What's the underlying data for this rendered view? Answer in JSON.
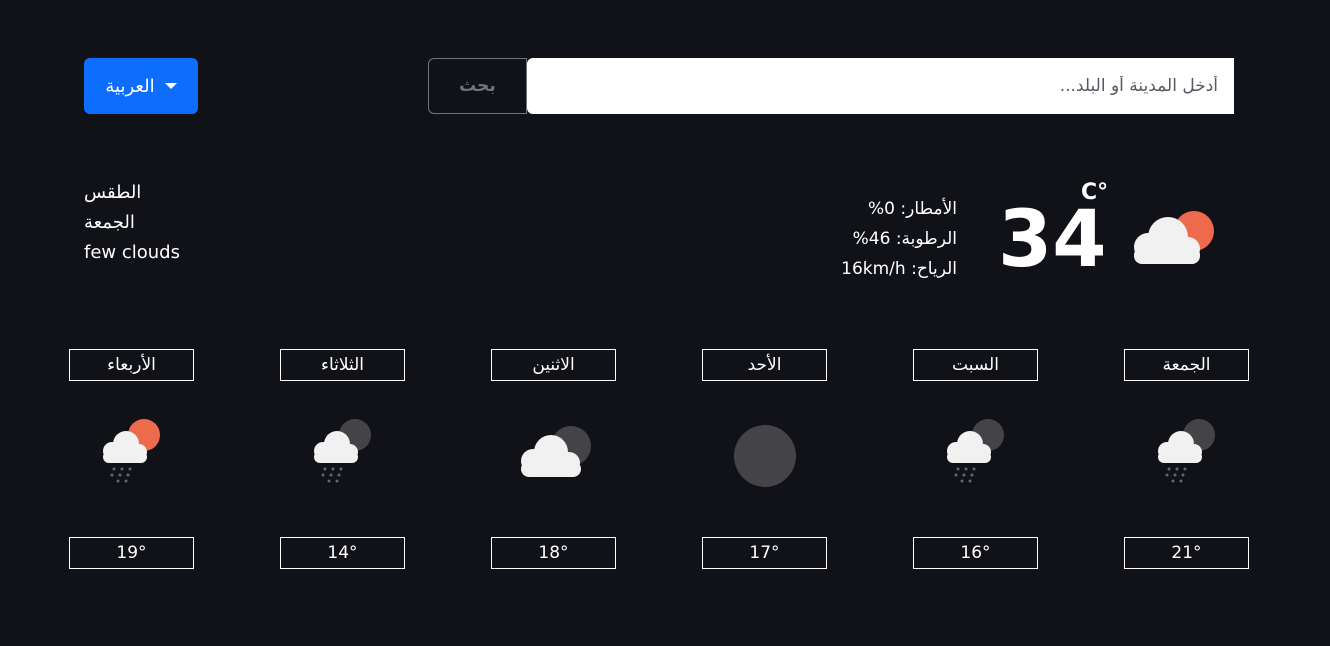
{
  "header": {
    "language_label": "العربية",
    "search_button_label": "بحث",
    "search_placeholder": "أدخل المدينة أو البلد...",
    "search_value": ""
  },
  "current": {
    "title": "الطقس",
    "day": "الجمعة",
    "description": "few clouds",
    "precipitation": "الأمطار: 0%",
    "humidity": "الرطوبة: 46%",
    "wind": "الرياح: 16km/h",
    "temperature": "34",
    "unit": "C°",
    "icon": "sun-behind-cloud-icon"
  },
  "forecast": [
    {
      "day": "الجمعة",
      "temp": "21°",
      "icon": "night-cloud-rain-icon"
    },
    {
      "day": "السبت",
      "temp": "16°",
      "icon": "night-cloud-rain-icon"
    },
    {
      "day": "الأحد",
      "temp": "17°",
      "icon": "clear-night-icon"
    },
    {
      "day": "الاثنين",
      "temp": "18°",
      "icon": "night-cloud-icon"
    },
    {
      "day": "الثلاثاء",
      "temp": "14°",
      "icon": "night-cloud-rain-icon"
    },
    {
      "day": "الأربعاء",
      "temp": "19°",
      "icon": "sun-cloud-rain-icon"
    }
  ],
  "colors": {
    "background": "#111217",
    "accent": "#0d6efd",
    "sun": "#ee6a4c",
    "moon": "#444448",
    "cloud": "#f1f1f1"
  }
}
